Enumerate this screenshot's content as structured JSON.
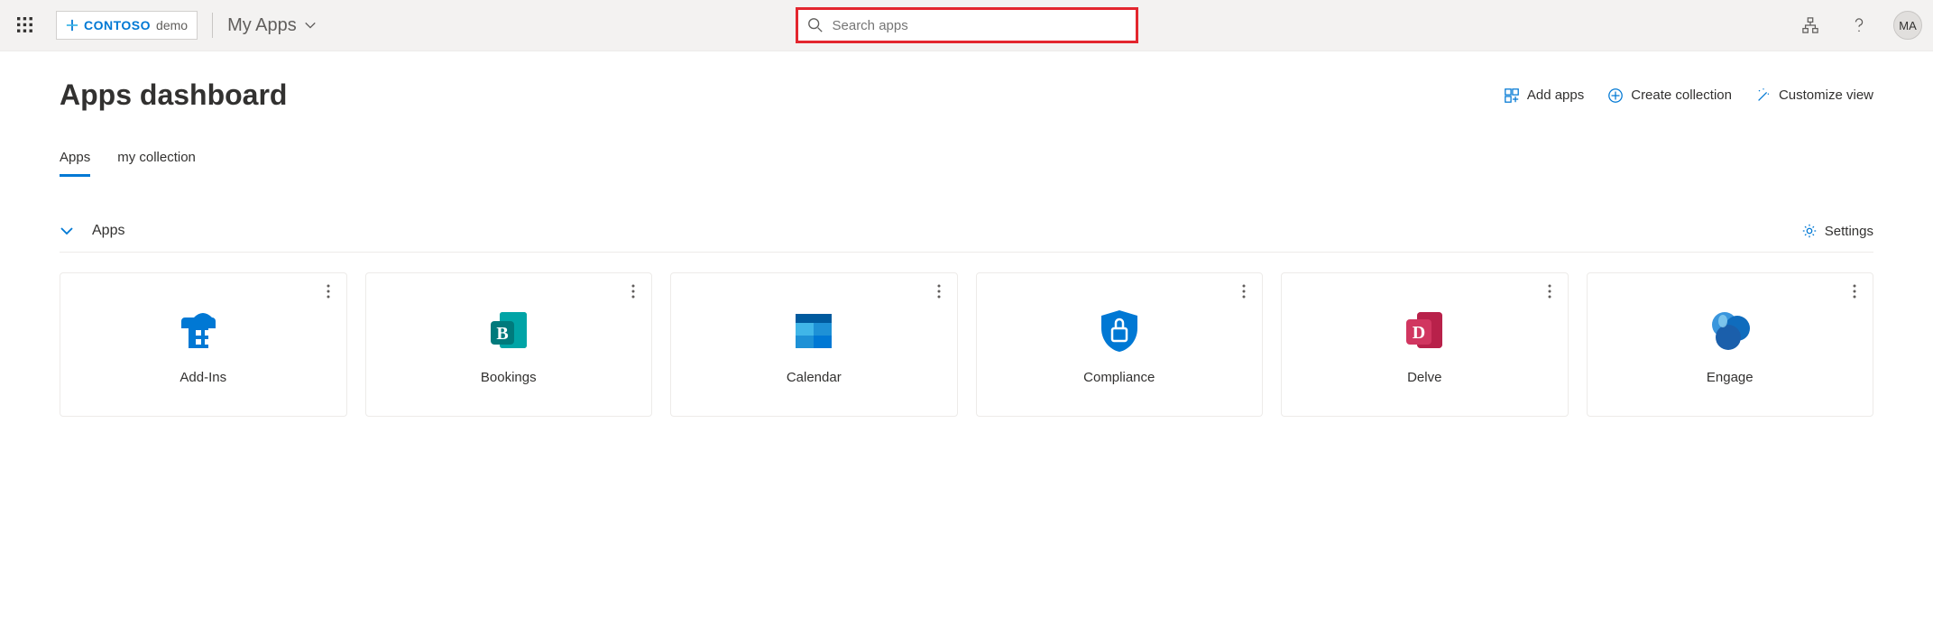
{
  "header": {
    "brand_name": "CONTOSO",
    "brand_suffix": "demo",
    "context_label": "My Apps",
    "search_placeholder": "Search apps",
    "avatar_initials": "MA"
  },
  "page": {
    "title": "Apps dashboard"
  },
  "actions": {
    "add_apps": "Add apps",
    "create_collection": "Create collection",
    "customize_view": "Customize view"
  },
  "tabs": [
    {
      "label": "Apps",
      "active": true
    },
    {
      "label": "my collection",
      "active": false
    }
  ],
  "section": {
    "title": "Apps",
    "settings_label": "Settings"
  },
  "apps": [
    {
      "name": "Add-Ins",
      "icon": "addins"
    },
    {
      "name": "Bookings",
      "icon": "bookings"
    },
    {
      "name": "Calendar",
      "icon": "calendar"
    },
    {
      "name": "Compliance",
      "icon": "compliance"
    },
    {
      "name": "Delve",
      "icon": "delve"
    },
    {
      "name": "Engage",
      "icon": "engage"
    }
  ],
  "colors": {
    "accent": "#0078d4",
    "highlight_border": "#e3262e"
  }
}
